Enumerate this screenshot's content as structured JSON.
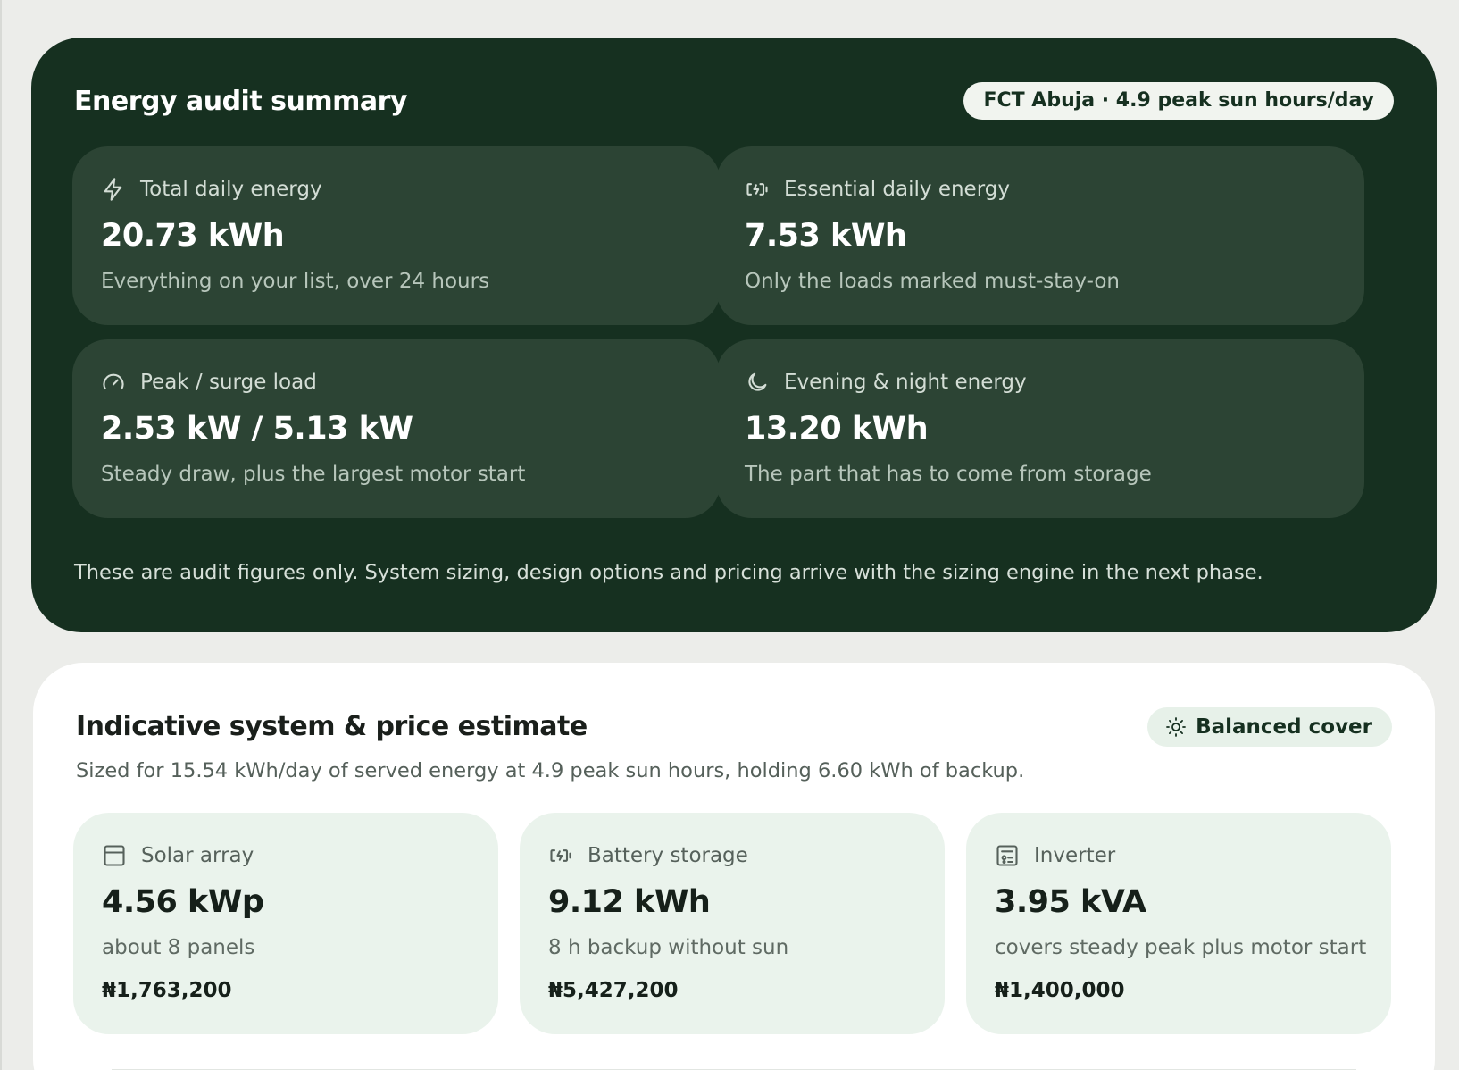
{
  "summary": {
    "title": "Energy audit summary",
    "location_badge": "FCT Abuja · 4.9 peak sun hours/day",
    "cards": [
      {
        "icon": "lightning-icon",
        "label": "Total daily energy",
        "value": "20.73 kWh",
        "description": "Everything on your list, over 24 hours"
      },
      {
        "icon": "battery-charging-icon",
        "label": "Essential daily energy",
        "value": "7.53 kWh",
        "description": "Only the loads marked must-stay-on"
      },
      {
        "icon": "gauge-icon",
        "label": "Peak / surge load",
        "value": "2.53 kW / 5.13 kW",
        "description": "Steady draw, plus the largest motor start"
      },
      {
        "icon": "moon-icon",
        "label": "Evening & night energy",
        "value": "13.20 kWh",
        "description": "The part that has to come from storage"
      }
    ],
    "note": "These are audit figures only. System sizing, design options and pricing arrive with the sizing engine in the next phase."
  },
  "estimate": {
    "title": "Indicative system & price estimate",
    "mode_badge": "Balanced cover",
    "mode_icon": "sun-icon",
    "subtitle": "Sized for 15.54 kWh/day of served energy at 4.9 peak sun hours, holding 6.60 kWh of backup.",
    "components": [
      {
        "icon": "solar-panel-icon",
        "label": "Solar array",
        "value": "4.56 kWp",
        "description": "about 8 panels",
        "price": "₦1,763,200"
      },
      {
        "icon": "battery-charging-icon",
        "label": "Battery storage",
        "value": "9.12 kWh",
        "description": "8 h backup without sun",
        "price": "₦5,427,200"
      },
      {
        "icon": "inverter-icon",
        "label": "Inverter",
        "value": "3.95 kVA",
        "description": "covers steady peak plus motor start",
        "price": "₦1,400,000"
      }
    ]
  },
  "colors": {
    "page_bg": "#ecedea",
    "summary_bg": "#163020",
    "summary_card_bg": "#2c4434",
    "estimate_card_bg": "#eaf3ec",
    "accent_pill": "#e7f1e9"
  }
}
